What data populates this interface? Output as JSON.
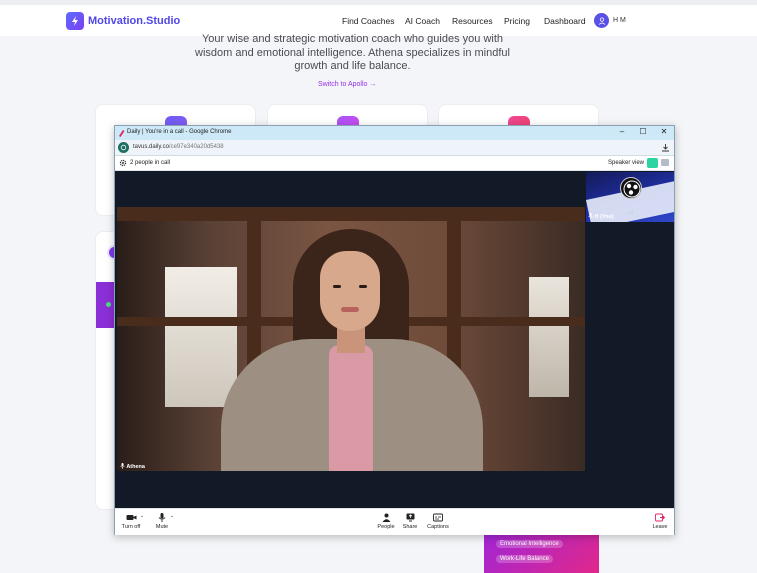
{
  "site": {
    "brand": "Motivation.Studio",
    "nav": [
      "Find Coaches",
      "AI Coach",
      "Resources",
      "Pricing",
      "Dashboard"
    ],
    "user_name": "H M",
    "hero_desc": "Your wise and strategic motivation coach who guides you with wisdom and emotional intelligence. Athena specializes in mindful growth and life balance.",
    "switch_link": "Switch to Apollo →",
    "tags": [
      "Emotional Intelligence",
      "Work-Life Balance"
    ]
  },
  "window": {
    "title": "Daily | You're in a call - Google Chrome",
    "url_host": "tavus.daily.co",
    "url_path": "/ce97e340a20d5438",
    "minimize": "–",
    "maximize": "☐",
    "close": "✕"
  },
  "call": {
    "people_count": "2 people in call",
    "speaker_view": "Speaker view",
    "self_label": "H (You)",
    "remote_label": "Athena"
  },
  "toolbar": {
    "turn_off": "Turn off",
    "mute": "Mute",
    "people": "People",
    "share": "Share",
    "captions": "Captions",
    "leave": "Leave"
  },
  "colors": {
    "brand": "#4f46e5",
    "accent_purple": "#9333ea",
    "leave_red": "#e0245e",
    "call_bg": "#121a28"
  }
}
